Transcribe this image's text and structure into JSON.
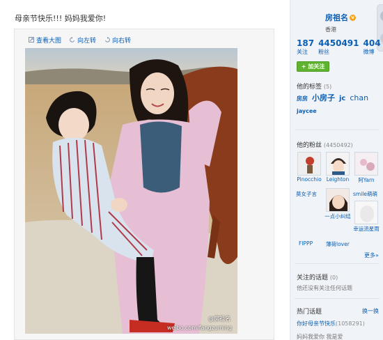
{
  "post": {
    "text": "母亲节快乐!!! 妈妈我爱你!"
  },
  "photo_tools": {
    "view_large": "查看大图",
    "rotate_left": "向左转",
    "rotate_right": "向右转"
  },
  "photo": {
    "watermark_user": "@房祖名",
    "watermark_url": "weibo.com/fangzuming"
  },
  "profile": {
    "name": "房祖名",
    "verified_icon": "v-badge-icon",
    "location": "香港",
    "stats": [
      {
        "num": "187",
        "label": "关注"
      },
      {
        "num": "4450491",
        "label": "粉丝"
      },
      {
        "num": "404",
        "label": "微博"
      }
    ],
    "follow_button": "+ 加关注"
  },
  "tags": {
    "title": "他的标签",
    "count": "(5)",
    "items": [
      "房房",
      "小房子",
      "jc",
      "chan",
      "jaycee"
    ]
  },
  "fans": {
    "title": "他的粉丝",
    "count": "(4450492)",
    "items": [
      "Pinocchio",
      "Leighton",
      "阿Yarn",
      "莫女子言",
      "一点小纠结",
      "smile萌萌",
      "FIPPP",
      "薄荷lover",
      "幸运流星雨"
    ],
    "more": "更多»"
  },
  "topics": {
    "title": "关注的话题",
    "count": "(0)",
    "empty": "他还没有关注任何话题"
  },
  "hot_topics": {
    "title": "热门话题",
    "change": "换一换",
    "first": "你好母亲节快乐",
    "first_count": "(1058291)",
    "second": "妈妈我爱你 我是爱"
  },
  "colors": {
    "link_blue": "#0a5fb4",
    "follow_green": "#5fb32e",
    "sidebar_bg": "#f0f3f8"
  }
}
